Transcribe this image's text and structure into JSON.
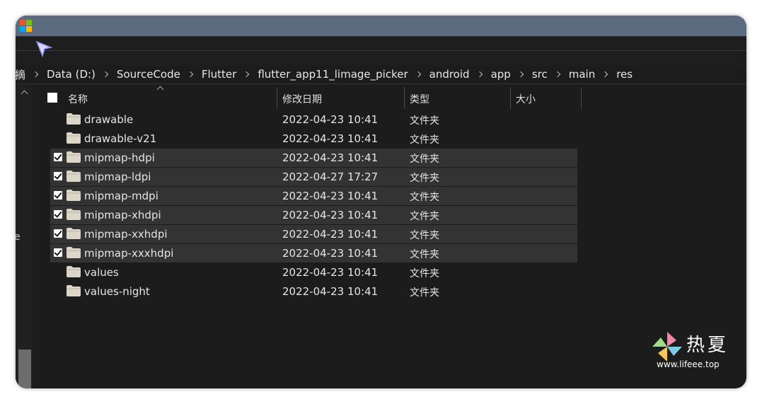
{
  "breadcrumb": [
    {
      "label": "摘"
    },
    {
      "label": "Data (D:)"
    },
    {
      "label": "SourceCode"
    },
    {
      "label": "Flutter"
    },
    {
      "label": "flutter_app11_limage_picker"
    },
    {
      "label": "android"
    },
    {
      "label": "app"
    },
    {
      "label": "src"
    },
    {
      "label": "main"
    },
    {
      "label": "res"
    }
  ],
  "nav_pane": {
    "fragment": "e"
  },
  "columns": {
    "name": "名称",
    "date": "修改日期",
    "type": "类型",
    "size": "大小"
  },
  "files": [
    {
      "name": "drawable",
      "date": "2022-04-23 10:41",
      "type": "文件夹",
      "selected": false
    },
    {
      "name": "drawable-v21",
      "date": "2022-04-23 10:41",
      "type": "文件夹",
      "selected": false
    },
    {
      "name": "mipmap-hdpi",
      "date": "2022-04-23 10:41",
      "type": "文件夹",
      "selected": true
    },
    {
      "name": "mipmap-ldpi",
      "date": "2022-04-27 17:27",
      "type": "文件夹",
      "selected": true
    },
    {
      "name": "mipmap-mdpi",
      "date": "2022-04-23 10:41",
      "type": "文件夹",
      "selected": true
    },
    {
      "name": "mipmap-xhdpi",
      "date": "2022-04-23 10:41",
      "type": "文件夹",
      "selected": true
    },
    {
      "name": "mipmap-xxhdpi",
      "date": "2022-04-23 10:41",
      "type": "文件夹",
      "selected": true
    },
    {
      "name": "mipmap-xxxhdpi",
      "date": "2022-04-23 10:41",
      "type": "文件夹",
      "selected": true
    },
    {
      "name": "values",
      "date": "2022-04-23 10:41",
      "type": "文件夹",
      "selected": false
    },
    {
      "name": "values-night",
      "date": "2022-04-23 10:41",
      "type": "文件夹",
      "selected": false
    }
  ],
  "watermark": {
    "title": "热夏",
    "url": "www.lifeee.top"
  },
  "colors": {
    "titlebar": "#5d6b80",
    "background": "#1c1c1c",
    "selected_row": "#333333",
    "folder": "#dcd6c8"
  }
}
